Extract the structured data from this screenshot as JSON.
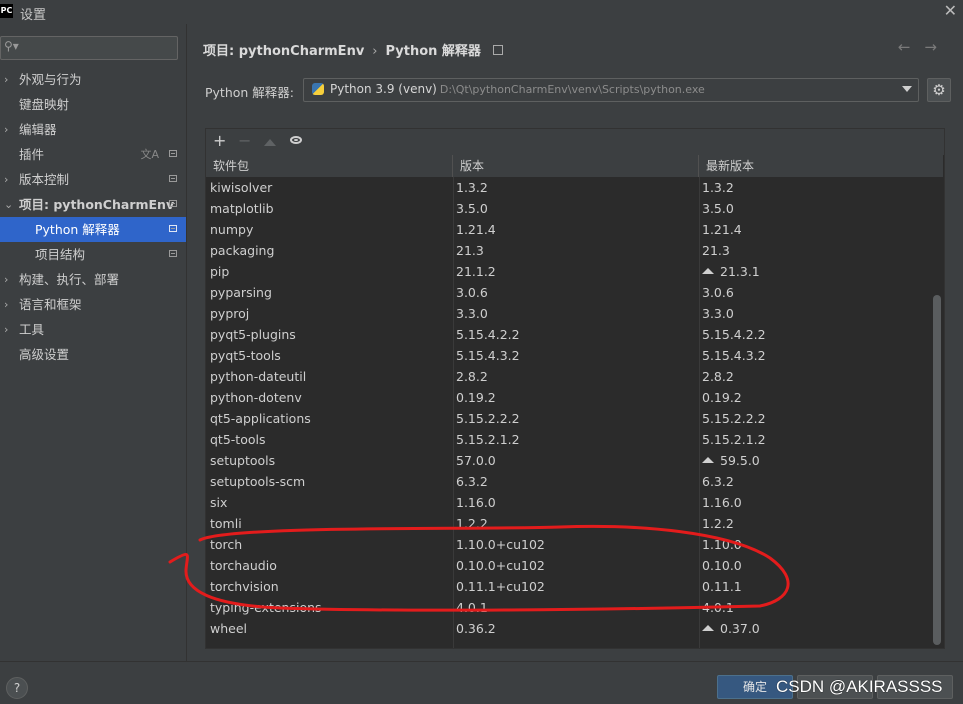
{
  "window": {
    "app_icon": "PC",
    "title": "设置"
  },
  "sidebar": {
    "search_placeholder": "",
    "items": [
      {
        "label": "外观与行为",
        "expand": "›",
        "level": 0
      },
      {
        "label": "键盘映射",
        "expand": "",
        "level": 0
      },
      {
        "label": "编辑器",
        "expand": "›",
        "level": 0
      },
      {
        "label": "插件",
        "expand": "",
        "level": 0
      },
      {
        "label": "版本控制",
        "expand": "›",
        "level": 0
      },
      {
        "label": "项目: pythonCharmEnv",
        "expand": "⌄",
        "level": 0
      },
      {
        "label": "Python 解释器",
        "expand": "",
        "level": 1
      },
      {
        "label": "项目结构",
        "expand": "",
        "level": 1
      },
      {
        "label": "构建、执行、部署",
        "expand": "›",
        "level": 0
      },
      {
        "label": "语言和框架",
        "expand": "›",
        "level": 0
      },
      {
        "label": "工具",
        "expand": "›",
        "level": 0
      },
      {
        "label": "高级设置",
        "expand": "",
        "level": 0
      }
    ]
  },
  "breadcrumb": {
    "project": "项目: pythonCharmEnv",
    "separator": "›",
    "page": "Python 解释器"
  },
  "interpreter": {
    "label": "Python 解释器:",
    "name": "Python 3.9 (venv)",
    "path": "D:\\Qt\\pythonCharmEnv\\venv\\Scripts\\python.exe"
  },
  "toolbar": {
    "add": "+",
    "remove": "−"
  },
  "table": {
    "headers": [
      "软件包",
      "版本",
      "最新版本"
    ],
    "rows": [
      {
        "pkg": "kiwisolver",
        "ver": "1.3.2",
        "latest": "1.3.2",
        "upgrade": false
      },
      {
        "pkg": "matplotlib",
        "ver": "3.5.0",
        "latest": "3.5.0",
        "upgrade": false
      },
      {
        "pkg": "numpy",
        "ver": "1.21.4",
        "latest": "1.21.4",
        "upgrade": false
      },
      {
        "pkg": "packaging",
        "ver": "21.3",
        "latest": "21.3",
        "upgrade": false
      },
      {
        "pkg": "pip",
        "ver": "21.1.2",
        "latest": "21.3.1",
        "upgrade": true
      },
      {
        "pkg": "pyparsing",
        "ver": "3.0.6",
        "latest": "3.0.6",
        "upgrade": false
      },
      {
        "pkg": "pyproj",
        "ver": "3.3.0",
        "latest": "3.3.0",
        "upgrade": false
      },
      {
        "pkg": "pyqt5-plugins",
        "ver": "5.15.4.2.2",
        "latest": "5.15.4.2.2",
        "upgrade": false
      },
      {
        "pkg": "pyqt5-tools",
        "ver": "5.15.4.3.2",
        "latest": "5.15.4.3.2",
        "upgrade": false
      },
      {
        "pkg": "python-dateutil",
        "ver": "2.8.2",
        "latest": "2.8.2",
        "upgrade": false
      },
      {
        "pkg": "python-dotenv",
        "ver": "0.19.2",
        "latest": "0.19.2",
        "upgrade": false
      },
      {
        "pkg": "qt5-applications",
        "ver": "5.15.2.2.2",
        "latest": "5.15.2.2.2",
        "upgrade": false
      },
      {
        "pkg": "qt5-tools",
        "ver": "5.15.2.1.2",
        "latest": "5.15.2.1.2",
        "upgrade": false
      },
      {
        "pkg": "setuptools",
        "ver": "57.0.0",
        "latest": "59.5.0",
        "upgrade": true
      },
      {
        "pkg": "setuptools-scm",
        "ver": "6.3.2",
        "latest": "6.3.2",
        "upgrade": false
      },
      {
        "pkg": "six",
        "ver": "1.16.0",
        "latest": "1.16.0",
        "upgrade": false
      },
      {
        "pkg": "tomli",
        "ver": "1.2.2",
        "latest": "1.2.2",
        "upgrade": false
      },
      {
        "pkg": "torch",
        "ver": "1.10.0+cu102",
        "latest": "1.10.0",
        "upgrade": false
      },
      {
        "pkg": "torchaudio",
        "ver": "0.10.0+cu102",
        "latest": "0.10.0",
        "upgrade": false
      },
      {
        "pkg": "torchvision",
        "ver": "0.11.1+cu102",
        "latest": "0.11.1",
        "upgrade": false
      },
      {
        "pkg": "typing-extensions",
        "ver": "4.0.1",
        "latest": "4.0.1",
        "upgrade": false
      },
      {
        "pkg": "wheel",
        "ver": "0.36.2",
        "latest": "0.37.0",
        "upgrade": true
      }
    ]
  },
  "footer": {
    "help": "?",
    "ok": "确定",
    "watermark": "CSDN @AKIRASSSS"
  },
  "colors": {
    "selected": "#2f65ca",
    "annotation": "#e31c1c",
    "ok_button": "#365880"
  }
}
